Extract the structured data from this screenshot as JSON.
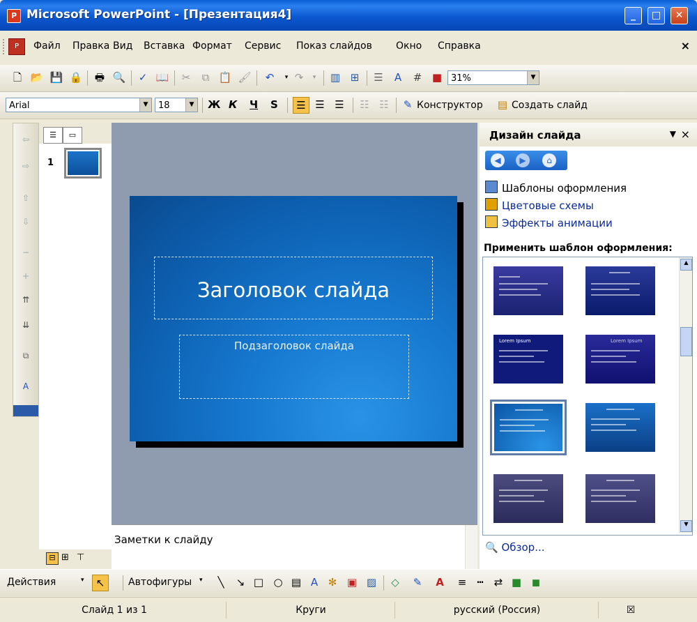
{
  "window": {
    "title": "Microsoft PowerPoint - [Презентация4]",
    "minimize": "_",
    "maximize": "□",
    "close": "✕"
  },
  "menu": {
    "items": [
      "Файл",
      "Правка",
      "Вид",
      "Вставка",
      "Формат",
      "Сервис",
      "Показ слайдов",
      "Окно",
      "Справка"
    ],
    "close": "×"
  },
  "standard_toolbar": {
    "zoom": "31%"
  },
  "format_toolbar": {
    "font": "Arial",
    "size": "18",
    "bold": "Ж",
    "italic": "К",
    "underline": "Ч",
    "shadow": "S",
    "designer": "Конструктор",
    "new_slide": "Создать слайд"
  },
  "outline": {
    "slide_number": "1"
  },
  "slide": {
    "title": "Заголовок слайда",
    "subtitle": "Подзаголовок слайда"
  },
  "notes": {
    "placeholder": "Заметки к слайду"
  },
  "task_pane": {
    "title": "Дизайн слайда",
    "links": [
      "Шаблоны оформления",
      "Цветовые схемы",
      "Эффекты анимации"
    ],
    "section_title": "Применить шаблон оформления:",
    "browse": "Обзор...",
    "template_preview_title": "Lorem Ipsum"
  },
  "drawing_toolbar": {
    "actions": "Действия",
    "autoshapes": "Автофигуры"
  },
  "status_bar": {
    "slide": "Слайд 1 из 1",
    "design": "Круги",
    "language": "русский (Россия)"
  },
  "colors": {
    "titlebar": "#0a5fd6",
    "slide_bg": "#1679cf",
    "accent_orange": "#f7c24a"
  }
}
